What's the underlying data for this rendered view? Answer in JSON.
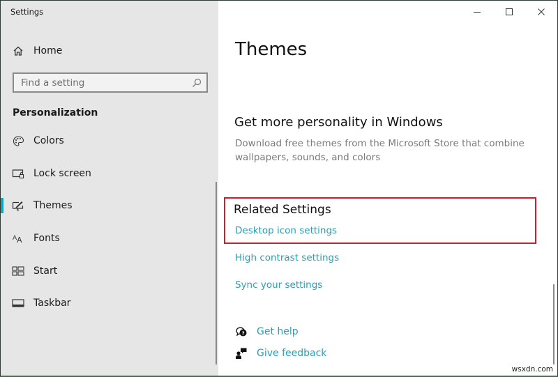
{
  "window": {
    "title": "Settings",
    "controls": {
      "minimize": "minimize-icon",
      "maximize": "maximize-icon",
      "close": "close-icon"
    }
  },
  "sidebar": {
    "home": {
      "label": "Home",
      "icon": "home-icon"
    },
    "search": {
      "placeholder": "Find a setting",
      "value": "",
      "icon": "search-icon"
    },
    "section_title": "Personalization",
    "items": [
      {
        "label": "Colors",
        "icon": "palette-icon",
        "active": false
      },
      {
        "label": "Lock screen",
        "icon": "lock-screen-icon",
        "active": false
      },
      {
        "label": "Themes",
        "icon": "themes-icon",
        "active": true
      },
      {
        "label": "Fonts",
        "icon": "fonts-icon",
        "active": false
      },
      {
        "label": "Start",
        "icon": "start-icon",
        "active": false
      },
      {
        "label": "Taskbar",
        "icon": "taskbar-icon",
        "active": false
      }
    ]
  },
  "main": {
    "title": "Themes",
    "promo": {
      "heading": "Get more personality in Windows",
      "description": "Download free themes from the Microsoft Store that combine wallpapers, sounds, and colors"
    },
    "related": {
      "heading": "Related Settings",
      "links": [
        "Desktop icon settings",
        "High contrast settings",
        "Sync your settings"
      ]
    },
    "help": [
      {
        "label": "Get help",
        "icon": "get-help-icon"
      },
      {
        "label": "Give feedback",
        "icon": "feedback-icon"
      }
    ]
  },
  "watermark": "wsxdn.com",
  "colors": {
    "accent": "#12a6b8",
    "link": "#2a9fb3",
    "highlight_box": "#c8202e",
    "sidebar_bg": "#e6e6e6"
  }
}
